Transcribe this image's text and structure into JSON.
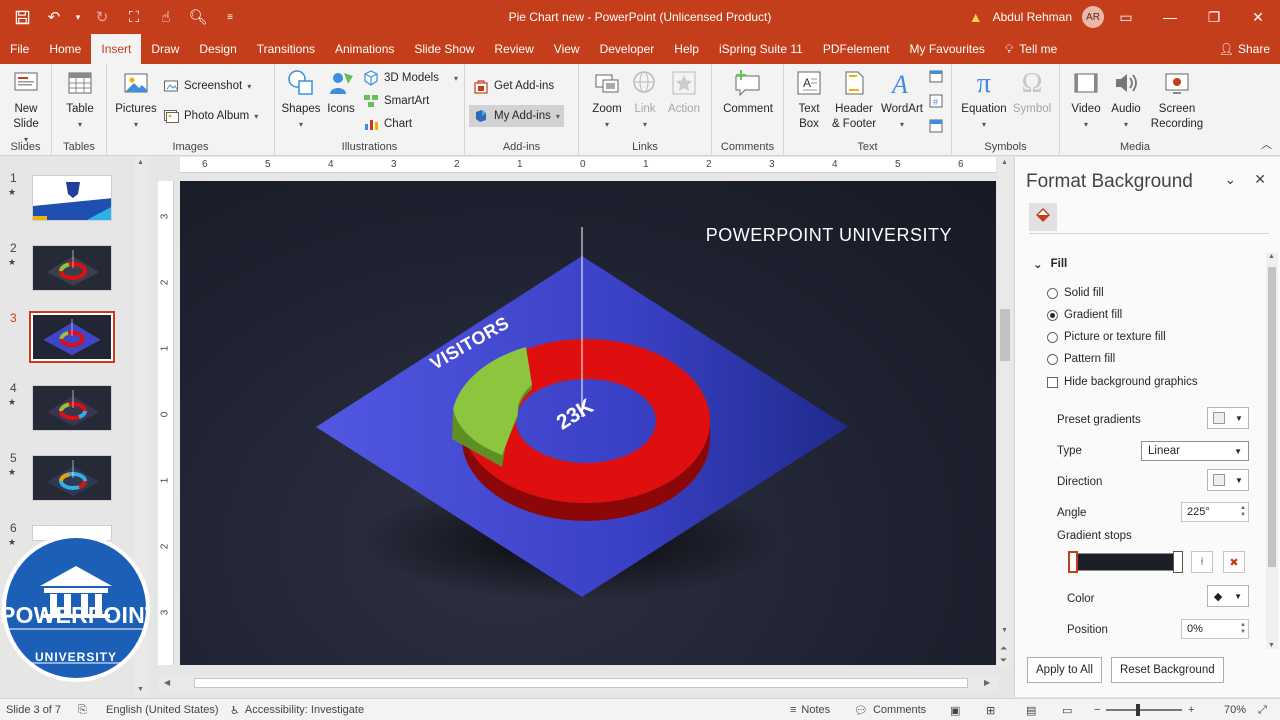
{
  "window": {
    "title": "Pie Chart new  -  PowerPoint (Unlicensed Product)",
    "user_name": "Abdul Rehman",
    "user_initials": "AR",
    "warning_icon": "warning-icon"
  },
  "colors": {
    "brand": "#c43e1c",
    "ribbon_bg": "#f3f3f3",
    "slide_bg": "#1e2230",
    "diamond": "#3f46c8",
    "ring": "#e00f0f",
    "segment": "#8cc63f"
  },
  "menu": {
    "tabs": [
      "File",
      "Home",
      "Insert",
      "Draw",
      "Design",
      "Transitions",
      "Animations",
      "Slide Show",
      "Review",
      "View",
      "Developer",
      "Help",
      "iSpring Suite 11",
      "PDFelement",
      "My Favourites"
    ],
    "active": "Insert",
    "tell_me": "Tell me",
    "share": "Share"
  },
  "ribbon": {
    "slides": {
      "label": "Slides",
      "new_slide": "New Slide"
    },
    "tables": {
      "label": "Tables",
      "table": "Table"
    },
    "images": {
      "label": "Images",
      "pictures": "Pictures",
      "screenshot": "Screenshot",
      "photo_album": "Photo Album"
    },
    "illustrations": {
      "label": "Illustrations",
      "shapes": "Shapes",
      "icons": "Icons",
      "models": "3D Models",
      "smartart": "SmartArt",
      "chart": "Chart"
    },
    "addins": {
      "label": "Add-ins",
      "get": "Get Add-ins",
      "my": "My Add-ins"
    },
    "links": {
      "label": "Links",
      "zoom": "Zoom",
      "link": "Link",
      "action": "Action"
    },
    "comments": {
      "label": "Comments",
      "comment": "Comment"
    },
    "text": {
      "label": "Text",
      "textbox_1": "Text",
      "textbox_2": "Box",
      "header_1": "Header",
      "header_2": "& Footer",
      "wordart": "WordArt"
    },
    "symbols": {
      "label": "Symbols",
      "equation": "Equation",
      "symbol": "Symbol"
    },
    "media": {
      "label": "Media",
      "video": "Video",
      "audio": "Audio",
      "screen_1": "Screen",
      "screen_2": "Recording"
    }
  },
  "ruler": {
    "h": [
      "6",
      "5",
      "4",
      "3",
      "2",
      "1",
      "0",
      "1",
      "2",
      "3",
      "4",
      "5",
      "6"
    ],
    "v": [
      "3",
      "2",
      "1",
      "0",
      "1",
      "2",
      "3"
    ]
  },
  "thumbnails": {
    "numbers": [
      "1",
      "2",
      "3",
      "4",
      "5",
      "6"
    ],
    "selected": 3
  },
  "logo": {
    "text_top": "POWERPOINT",
    "text_bottom": "UNIVERSITY"
  },
  "slide": {
    "title": "POWERPOINT UNIVERSITY",
    "label": "VISITORS",
    "value": "23K"
  },
  "pane": {
    "title": "Format Background",
    "section": "Fill",
    "options": [
      "Solid fill",
      "Gradient fill",
      "Picture or texture fill",
      "Pattern fill"
    ],
    "selected_option": "Gradient fill",
    "hide_bg": "Hide background graphics",
    "preset": "Preset gradients",
    "type_label": "Type",
    "type_value": "Linear",
    "direction": "Direction",
    "angle_label": "Angle",
    "angle_value": "225°",
    "stops_label": "Gradient stops",
    "color_label": "Color",
    "position_label": "Position",
    "position_value": "0%",
    "apply_all": "Apply to All",
    "reset": "Reset Background"
  },
  "status": {
    "slide": "Slide 3 of 7",
    "language": "English (United States)",
    "accessibility": "Accessibility: Investigate",
    "notes": "Notes",
    "comments": "Comments",
    "zoom": "70%"
  }
}
